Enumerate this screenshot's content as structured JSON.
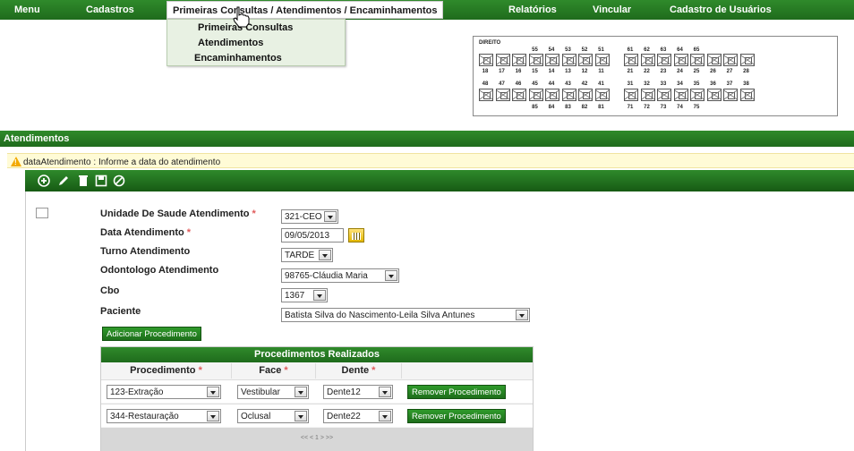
{
  "menu": {
    "items": [
      {
        "label": "Menu"
      },
      {
        "label": "Cadastros"
      },
      {
        "label": "Primeiras Consultas / Atendimentos / Encaminhamentos"
      },
      {
        "label": "Relatórios"
      },
      {
        "label": "Vincular"
      },
      {
        "label": "Cadastro de Usuários"
      }
    ],
    "dropdown": [
      "Primeiras Consultas",
      "Atendimentos",
      "Encaminhamentos"
    ]
  },
  "odontogram": {
    "label": "DIREITO",
    "row1_top_numbers": [
      "55",
      "54",
      "53",
      "52",
      "51",
      "61",
      "62",
      "63",
      "64",
      "65"
    ],
    "row1_bottom_numbers": [
      "18",
      "17",
      "16",
      "15",
      "14",
      "13",
      "12",
      "11",
      "21",
      "22",
      "23",
      "24",
      "25",
      "26",
      "27",
      "28"
    ],
    "row2_top_numbers": [
      "48",
      "47",
      "46",
      "45",
      "44",
      "43",
      "42",
      "41",
      "31",
      "32",
      "33",
      "34",
      "35",
      "36",
      "37",
      "38"
    ],
    "row2_bottom_numbers": [
      "85",
      "84",
      "83",
      "82",
      "81",
      "71",
      "72",
      "73",
      "74",
      "75"
    ]
  },
  "panel": {
    "title": "Atendimentos",
    "alert": "dataAtendimento : Informe a data do atendimento"
  },
  "toolbar": {
    "icons": [
      "add-icon",
      "edit-icon",
      "delete-icon",
      "save-icon",
      "cancel-icon"
    ]
  },
  "form": {
    "unidade_label": "Unidade De Saude Atendimento",
    "unidade_value": "321-CEO",
    "data_label": "Data Atendimento",
    "data_value": "09/05/2013",
    "turno_label": "Turno Atendimento",
    "turno_value": "TARDE",
    "odontologo_label": "Odontologo Atendimento",
    "odontologo_value": "98765-Cláudia Maria",
    "cbo_label": "Cbo",
    "cbo_value": "1367",
    "paciente_label": "Paciente",
    "paciente_value": "Batista Silva do Nascimento-Leila Silva Antunes",
    "required_mark": "*",
    "add_button": "Adicionar Procedimento"
  },
  "procedures_table": {
    "caption": "Procedimentos Realizados",
    "headers": [
      "Procedimento",
      "Face",
      "Dente"
    ],
    "rows": [
      {
        "procedimento": "123-Extração",
        "face": "Vestibular",
        "dente": "Dente12",
        "action": "Remover Procedimento"
      },
      {
        "procedimento": "344-Restauração",
        "face": "Oclusal",
        "dente": "Dente22",
        "action": "Remover Procedimento"
      }
    ],
    "pager": "<< < 1 > >>"
  }
}
